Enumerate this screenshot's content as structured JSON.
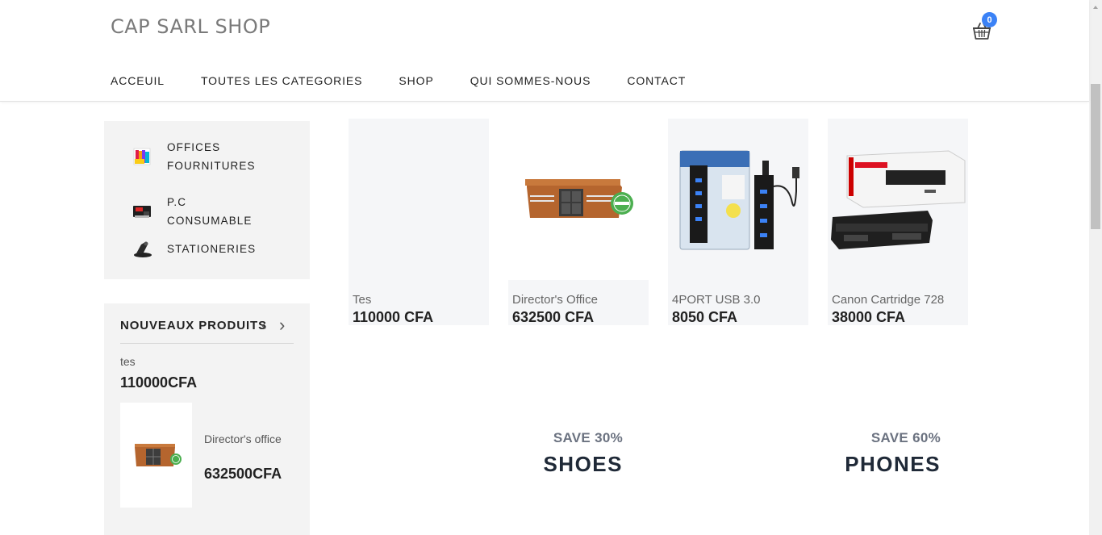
{
  "header": {
    "brand": "CAP SARL SHOP",
    "cart_count": "0",
    "accent_color": "#3b82f6",
    "cart_icon": "basket-icon"
  },
  "nav": {
    "items": [
      {
        "label": "ACCEUIL"
      },
      {
        "label": "TOUTES LES CATEGORIES"
      },
      {
        "label": "SHOP"
      },
      {
        "label": "QUI SOMMES-NOUS"
      },
      {
        "label": "CONTACT"
      }
    ]
  },
  "categories": {
    "items": [
      {
        "label": "OFFICES FOURNITURES",
        "icon": "office-supplies-icon"
      },
      {
        "label": "P.C CONSUMABLE",
        "icon": "toner-icon"
      },
      {
        "label": "STATIONERIES",
        "icon": "stapler-icon"
      }
    ]
  },
  "new_products": {
    "title": "NOUVEAUX PRODUITS",
    "prev": "‹",
    "next": "›",
    "items": [
      {
        "name": "tes",
        "price": "110000CFA"
      },
      {
        "name": "Director's office",
        "price": "632500CFA"
      }
    ]
  },
  "products": [
    {
      "name": "Tes",
      "price": "110000 CFA"
    },
    {
      "name": "Director's Office",
      "price": "632500 CFA"
    },
    {
      "name": "4PORT USB 3.0",
      "price": "8050 CFA"
    },
    {
      "name": "Canon Cartridge 728",
      "price": "38000 CFA"
    }
  ],
  "banners": [
    {
      "save": "SAVE 30%",
      "title": "SHOES"
    },
    {
      "save": "SAVE 60%",
      "title": "PHONES"
    }
  ]
}
